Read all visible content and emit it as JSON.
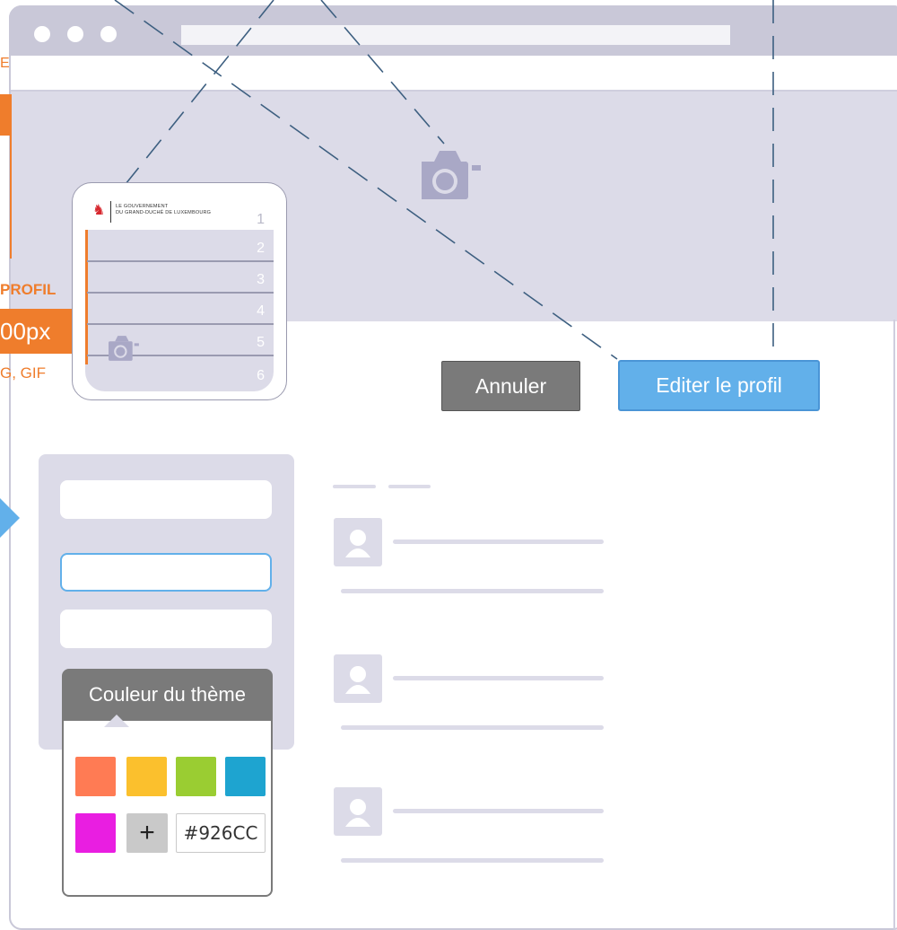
{
  "annotations": {
    "partial_top": "E",
    "profile_label": "PROFIL",
    "size_label": "00px",
    "formats_label": "G, GIF"
  },
  "profile_card": {
    "gov_line1": "LE GOUVERNEMENT",
    "gov_line2": "DU GRAND-DUCHÉ DE LUXEMBOURG",
    "rows": [
      "1",
      "2",
      "3",
      "4",
      "5",
      "6"
    ]
  },
  "buttons": {
    "cancel": "Annuler",
    "edit": "Editer le profil"
  },
  "theme_picker": {
    "title": "Couleur du thème",
    "swatches": [
      "#ff7b54",
      "#fbc02d",
      "#9acd32",
      "#1ea4d0",
      "#e91ee1"
    ],
    "add_label": "+",
    "hex_value": "#926CC"
  },
  "colors": {
    "accent_blue": "#62b0ea",
    "accent_orange": "#ef7d2c",
    "panel": "#dcdbe8",
    "button_gray": "#7a7a7a"
  }
}
